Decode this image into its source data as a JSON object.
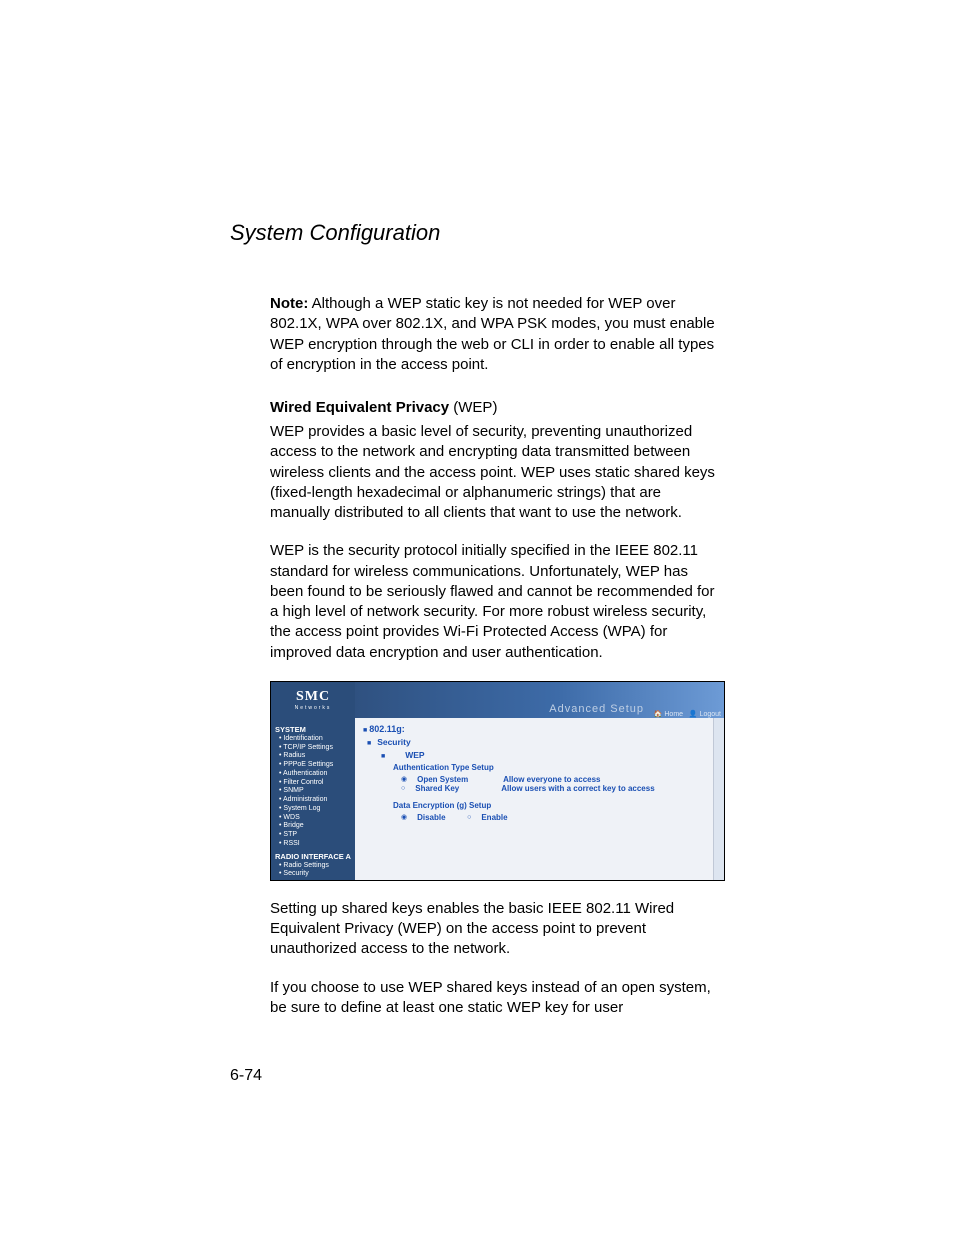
{
  "header": "System Configuration",
  "note": {
    "label": "Note:",
    "text": "Although a WEP static key is not needed for WEP over 802.1X, WPA over 802.1X, and WPA PSK modes, you must enable WEP encryption through the web or CLI in order to enable all types of encryption in the access point."
  },
  "wep_heading": {
    "strong": "Wired Equivalent Privacy",
    "rest": " (WEP)"
  },
  "para1": "WEP provides a basic level of security, preventing unauthorized access to the network and encrypting data transmitted between wireless clients and the access point. WEP uses static shared keys (fixed-length hexadecimal or alphanumeric strings) that are manually distributed to all clients that want to use the network.",
  "para2": "WEP is the security protocol initially specified in the IEEE 802.11 standard for wireless communications. Unfortunately, WEP has been found to be seriously flawed and cannot be recommended for a high level of network security. For more robust wireless security, the access point provides Wi-Fi Protected Access (WPA) for improved data encryption and user authentication.",
  "para3": "Setting up shared keys enables the basic IEEE 802.11 Wired Equivalent Privacy (WEP) on the access point to prevent unauthorized access to the network.",
  "para4": "If you choose to use WEP shared keys instead of an open system, be sure to define at least one static WEP key for user",
  "page_num": "6-74",
  "router": {
    "logo": {
      "main": "SMC",
      "sub": "Networks"
    },
    "banner_title": "Advanced Setup",
    "tabs": {
      "home": "Home",
      "logout": "Logout"
    },
    "sidebar": {
      "system_hdr": "SYSTEM",
      "items": [
        "Identification",
        "TCP/IP Settings",
        "Radius",
        "PPPoE Settings",
        "Authentication",
        "Filter Control",
        "SNMP",
        "Administration",
        "System Log",
        "WDS",
        "Bridge",
        "STP",
        "RSSI"
      ],
      "radio_hdr": "RADIO INTERFACE A",
      "radio_items": [
        "Radio Settings",
        "Security"
      ]
    },
    "main": {
      "l1": "802.11g:",
      "l2": "Security",
      "l3": "WEP",
      "auth_hdr": "Authentication Type Setup",
      "open_system": "Open System",
      "open_desc": "Allow everyone to access",
      "shared_key": "Shared Key",
      "shared_desc": "Allow users with a correct key to access",
      "enc_hdr": "Data Encryption (g) Setup",
      "disable": "Disable",
      "enable": "Enable"
    }
  }
}
